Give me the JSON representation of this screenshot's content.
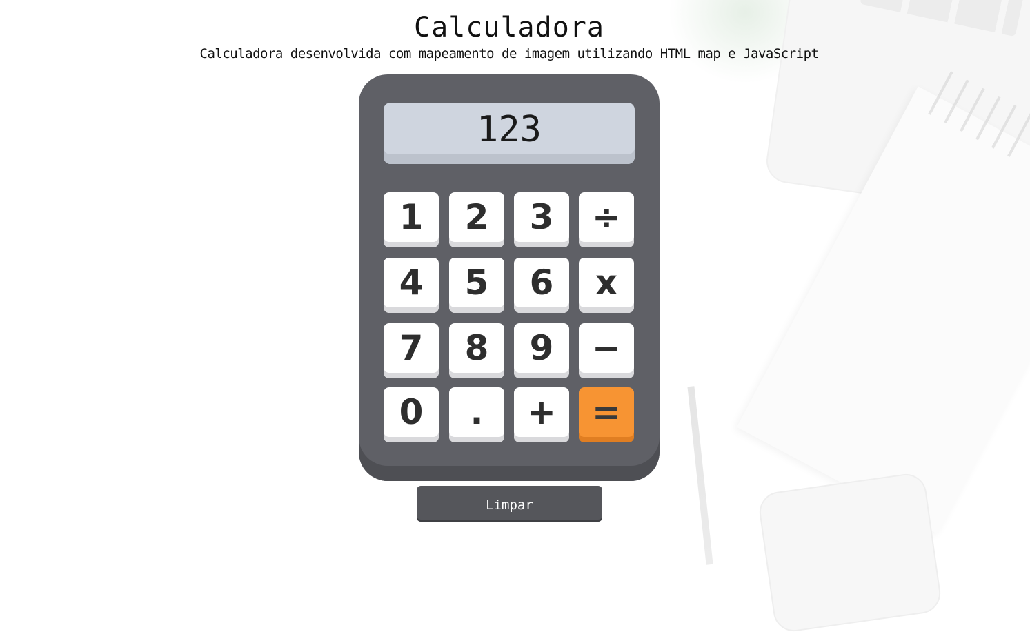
{
  "header": {
    "title": "Calculadora",
    "subtitle": "Calculadora desenvolvida com mapeamento de imagem utilizando HTML map e JavaScript"
  },
  "display": {
    "value": "123"
  },
  "keys": [
    "1",
    "2",
    "3",
    "÷",
    "4",
    "5",
    "6",
    "x",
    "7",
    "8",
    "9",
    "−",
    "0",
    ".",
    "+",
    "="
  ],
  "clear_button": {
    "label": "Limpar"
  },
  "colors": {
    "calculator_body": "#5f6066",
    "display": "#cfd5df",
    "key": "#ffffff",
    "equals_key": "#f79433",
    "clear_button": "#55565b"
  }
}
